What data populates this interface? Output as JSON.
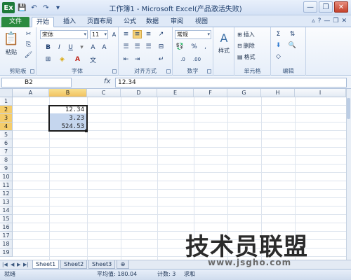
{
  "title": "工作簿1 - Microsoft Excel(产品激活失败)",
  "qat": {
    "app_icon": "Ex",
    "save": "💾",
    "undo": "↶",
    "redo": "↷",
    "customize": "▾"
  },
  "window_controls": {
    "minimize": "—",
    "restore": "❐",
    "close": "✕"
  },
  "tabs": [
    "文件",
    "开始",
    "插入",
    "页面布局",
    "公式",
    "数据",
    "审阅",
    "视图"
  ],
  "ribbon": {
    "clipboard": {
      "label": "剪贴板",
      "paste": "粘贴"
    },
    "font": {
      "label": "字体",
      "font_name": "宋体",
      "font_size": "11",
      "bold": "B",
      "italic": "I",
      "underline": "U",
      "grow": "A",
      "shrink": "A"
    },
    "alignment": {
      "label": "对齐方式"
    },
    "number": {
      "label": "数字",
      "format": "常规",
      "percent": "%",
      "comma": ","
    },
    "styles": {
      "label": "样式",
      "button": "样式"
    },
    "cells": {
      "label": "单元格",
      "insert": "插入",
      "delete": "删除",
      "format": "格式"
    },
    "editing": {
      "label": "编辑"
    }
  },
  "formula_bar": {
    "name_box": "B2",
    "fx": "fx",
    "value": "12.34"
  },
  "columns": [
    "A",
    "B",
    "C",
    "D",
    "E",
    "F",
    "G",
    "H",
    "I"
  ],
  "rows": [
    "1",
    "2",
    "3",
    "4",
    "5",
    "6",
    "7",
    "8",
    "9",
    "10",
    "11",
    "12",
    "13",
    "14",
    "15",
    "16",
    "17",
    "18",
    "19"
  ],
  "cells": [
    {
      "ref": "B2",
      "value": "12.34"
    },
    {
      "ref": "B3",
      "value": "3.23"
    },
    {
      "ref": "B4",
      "value": "524.53"
    }
  ],
  "sheets": [
    "Sheet1",
    "Sheet2",
    "Sheet3"
  ],
  "status": {
    "mode": "就绪",
    "average": "平均值: 180.04",
    "count": "计数: 3",
    "sum": "求和"
  },
  "watermark": {
    "logo": "技术员联盟",
    "url": "www.jsgho.com"
  },
  "colors": {
    "file_tab": "#2a8a3f",
    "selection": "#c5d6ee",
    "active_header": "#f5cd6b"
  }
}
